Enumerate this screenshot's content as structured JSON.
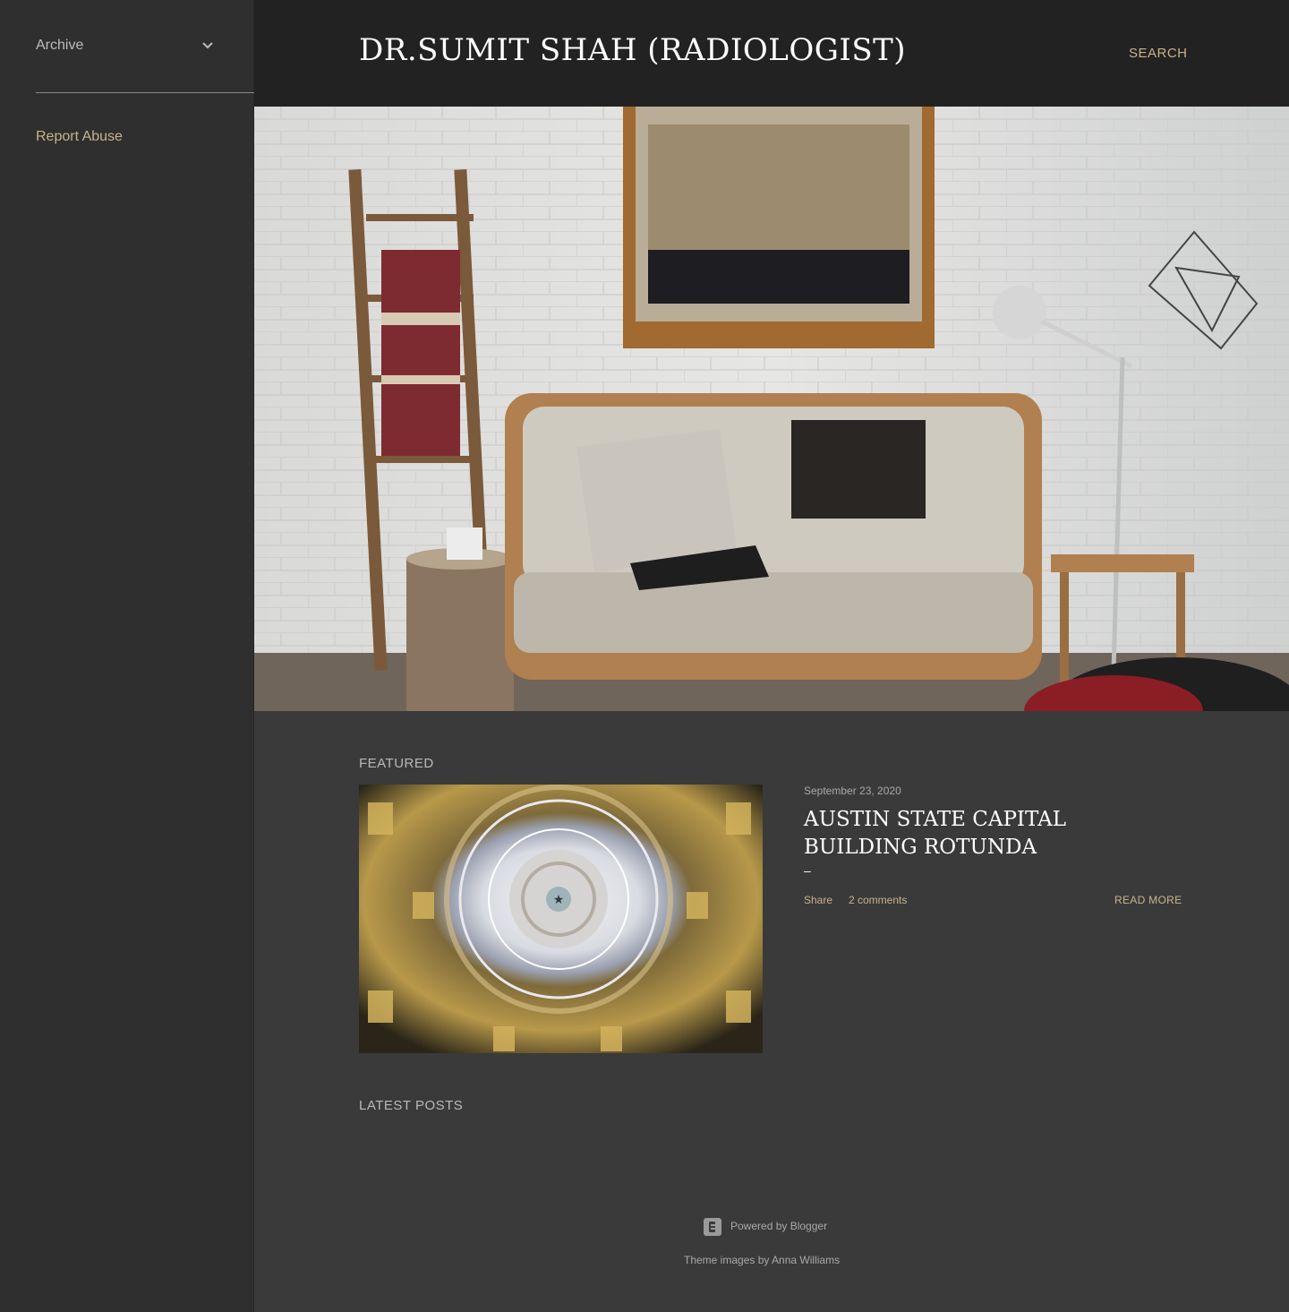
{
  "sidebar": {
    "archive_label": "Archive",
    "report_abuse": "Report Abuse"
  },
  "header": {
    "title": "DR.SUMIT SHAH (RADIOLOGIST)",
    "search_label": "SEARCH"
  },
  "featured": {
    "section_label": "FEATURED",
    "date": "September 23, 2020",
    "title": "AUSTIN STATE CAPITAL BUILDING ROTUNDA",
    "dash": "–",
    "share_label": "Share",
    "comments_label": "2 comments",
    "read_more_label": "READ MORE"
  },
  "latest": {
    "section_label": "LATEST POSTS"
  },
  "footer": {
    "powered_by": "Powered by Blogger",
    "theme_prefix": "Theme images by",
    "theme_author": "Anna Williams"
  },
  "colors": {
    "accent": "#c8b38a",
    "header_bg": "#222222",
    "sidebar_bg": "#2f2f2f",
    "main_bg": "#3a3a3a"
  }
}
